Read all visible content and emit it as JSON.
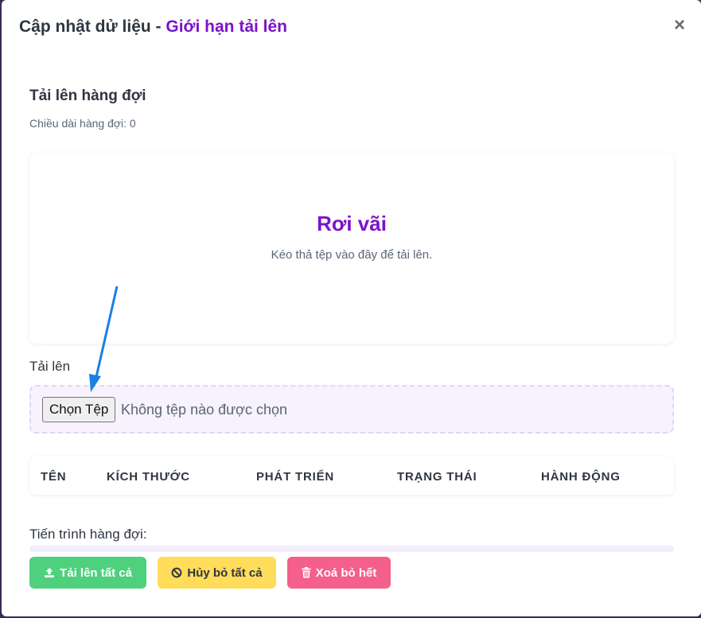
{
  "header": {
    "title_prefix": "Cập nhật dử liệu - ",
    "title_accent": "Giới hạn tải lên",
    "close_label": "×"
  },
  "queue": {
    "title": "Tải lên hàng đợi",
    "length_text": "Chiều dài hàng đợi: 0"
  },
  "dropzone": {
    "title": "Rơi vãi",
    "description": "Kéo thả tệp vào đây để tải lên."
  },
  "upload": {
    "label": "Tải lên",
    "button_label": "Chọn Tệp",
    "status_text": "Không tệp nào được chọn"
  },
  "table": {
    "columns": [
      "TÊN",
      "KÍCH THƯỚC",
      "PHÁT TRIỂN",
      "TRẠNG THÁI",
      "HÀNH ĐỘNG"
    ]
  },
  "progress": {
    "label": "Tiến trình hàng đợi:",
    "value": 0
  },
  "actions": {
    "upload_all": "Tải lên tất cả",
    "cancel_all": "Hủy bỏ tất cả",
    "remove_all": "Xoá bỏ hết"
  },
  "colors": {
    "accent": "#7d12c9",
    "success": "#4fd07d",
    "warning": "#ffdc5a",
    "danger": "#f45f8b",
    "annotation_arrow": "#1a7fe6"
  },
  "icons": {
    "upload_all": "upload-icon",
    "cancel_all": "ban-icon",
    "remove_all": "trash-icon",
    "close": "close-icon"
  }
}
